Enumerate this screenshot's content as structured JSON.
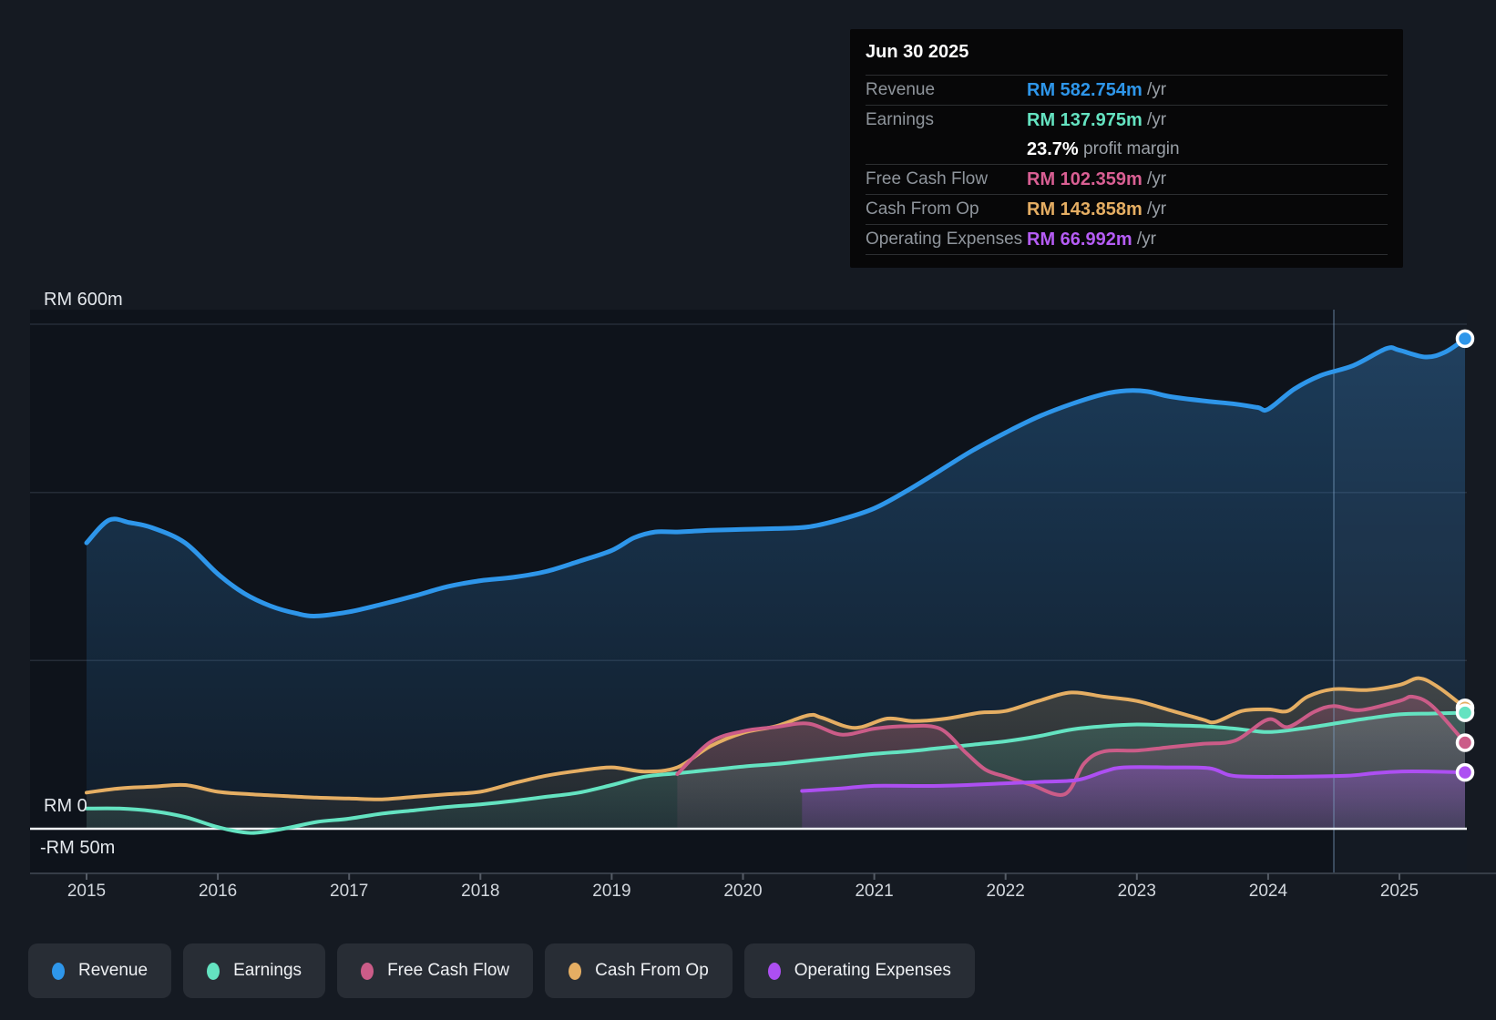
{
  "tooltip": {
    "date": "Jun 30 2025",
    "rows": [
      {
        "label": "Revenue",
        "value": "RM 582.754m",
        "suffix": " /yr",
        "color": "#2e96ea"
      },
      {
        "label": "Earnings",
        "value": "RM 137.975m",
        "suffix": " /yr",
        "color": "#64e3c1"
      },
      {
        "label": "",
        "value": "23.7%",
        "suffix": " profit margin",
        "color": "#ffffff",
        "sub": true
      },
      {
        "label": "Free Cash Flow",
        "value": "RM 102.359m",
        "suffix": " /yr",
        "color": "#d95f93"
      },
      {
        "label": "Cash From Op",
        "value": "RM 143.858m",
        "suffix": " /yr",
        "color": "#e5ae63"
      },
      {
        "label": "Operating Expenses",
        "value": "RM 66.992m",
        "suffix": " /yr",
        "color": "#b55cf5"
      }
    ]
  },
  "y_axis": {
    "top_label": "RM 600m",
    "zero_label": "RM 0",
    "negative_label": "-RM 50m"
  },
  "x_axis": {
    "years": [
      "2015",
      "2016",
      "2017",
      "2018",
      "2019",
      "2020",
      "2021",
      "2022",
      "2023",
      "2024",
      "2025"
    ]
  },
  "legend": [
    {
      "label": "Revenue",
      "color": "#2e96ea"
    },
    {
      "label": "Earnings",
      "color": "#64e3c1"
    },
    {
      "label": "Free Cash Flow",
      "color": "#cb5c88"
    },
    {
      "label": "Cash From Op",
      "color": "#e5ae63"
    },
    {
      "label": "Operating Expenses",
      "color": "#ad4ff2"
    }
  ],
  "chart_data": {
    "type": "area",
    "title": "Earnings and revenue history (RM millions per year)",
    "x_unit": "year",
    "x_range": [
      2015.0,
      2025.5
    ],
    "ylim": [
      -50,
      600
    ],
    "currency": "RM",
    "gridline_values_m": [
      600,
      400,
      200
    ],
    "zero_line_value": 0,
    "today_marker_year": 2024.5,
    "legend_position": "bottom",
    "series": [
      {
        "name": "Revenue",
        "color": "#2e96ea",
        "line_width": 5,
        "points": [
          [
            2015.0,
            340
          ],
          [
            2015.17,
            367
          ],
          [
            2015.33,
            364
          ],
          [
            2015.5,
            358
          ],
          [
            2015.75,
            340
          ],
          [
            2016.0,
            303
          ],
          [
            2016.2,
            280
          ],
          [
            2016.4,
            265
          ],
          [
            2016.6,
            256
          ],
          [
            2016.75,
            253
          ],
          [
            2017.0,
            258
          ],
          [
            2017.25,
            267
          ],
          [
            2017.5,
            277
          ],
          [
            2017.75,
            288
          ],
          [
            2018.0,
            295
          ],
          [
            2018.25,
            299
          ],
          [
            2018.5,
            306
          ],
          [
            2018.75,
            318
          ],
          [
            2019.0,
            331
          ],
          [
            2019.17,
            346
          ],
          [
            2019.33,
            353
          ],
          [
            2019.5,
            353
          ],
          [
            2019.75,
            355
          ],
          [
            2020.0,
            356
          ],
          [
            2020.25,
            357
          ],
          [
            2020.5,
            359
          ],
          [
            2020.75,
            368
          ],
          [
            2021.0,
            381
          ],
          [
            2021.25,
            402
          ],
          [
            2021.5,
            426
          ],
          [
            2021.75,
            450
          ],
          [
            2022.0,
            471
          ],
          [
            2022.25,
            490
          ],
          [
            2022.5,
            505
          ],
          [
            2022.75,
            517
          ],
          [
            2022.92,
            521
          ],
          [
            2023.08,
            520
          ],
          [
            2023.25,
            514
          ],
          [
            2023.5,
            509
          ],
          [
            2023.75,
            505
          ],
          [
            2023.92,
            501
          ],
          [
            2024.0,
            499
          ],
          [
            2024.2,
            523
          ],
          [
            2024.4,
            539
          ],
          [
            2024.65,
            551
          ],
          [
            2024.9,
            571
          ],
          [
            2025.0,
            569
          ],
          [
            2025.2,
            561
          ],
          [
            2025.35,
            567
          ],
          [
            2025.5,
            582.754
          ]
        ]
      },
      {
        "name": "Cash From Op",
        "color": "#e5ae63",
        "line_width": 4,
        "points": [
          [
            2015.0,
            43
          ],
          [
            2015.25,
            48
          ],
          [
            2015.5,
            50
          ],
          [
            2015.75,
            52
          ],
          [
            2016.0,
            44
          ],
          [
            2016.25,
            41
          ],
          [
            2016.5,
            39
          ],
          [
            2016.75,
            37
          ],
          [
            2017.0,
            36
          ],
          [
            2017.25,
            35
          ],
          [
            2017.5,
            38
          ],
          [
            2017.75,
            41
          ],
          [
            2018.0,
            44
          ],
          [
            2018.25,
            54
          ],
          [
            2018.5,
            63
          ],
          [
            2018.75,
            69
          ],
          [
            2019.0,
            73
          ],
          [
            2019.25,
            68
          ],
          [
            2019.5,
            73
          ],
          [
            2019.75,
            98
          ],
          [
            2020.0,
            114
          ],
          [
            2020.25,
            122
          ],
          [
            2020.5,
            135
          ],
          [
            2020.6,
            132
          ],
          [
            2020.85,
            120
          ],
          [
            2021.1,
            131
          ],
          [
            2021.3,
            128
          ],
          [
            2021.55,
            131
          ],
          [
            2021.8,
            138
          ],
          [
            2022.0,
            140
          ],
          [
            2022.25,
            152
          ],
          [
            2022.5,
            162
          ],
          [
            2022.75,
            157
          ],
          [
            2023.0,
            152
          ],
          [
            2023.25,
            141
          ],
          [
            2023.5,
            130
          ],
          [
            2023.6,
            127
          ],
          [
            2023.8,
            140
          ],
          [
            2024.0,
            142
          ],
          [
            2024.15,
            140
          ],
          [
            2024.3,
            157
          ],
          [
            2024.5,
            166
          ],
          [
            2024.75,
            165
          ],
          [
            2025.0,
            171
          ],
          [
            2025.15,
            179
          ],
          [
            2025.3,
            168
          ],
          [
            2025.5,
            143.858
          ]
        ]
      },
      {
        "name": "Free Cash Flow",
        "color": "#cb5c88",
        "line_width": 4,
        "points": [
          [
            2019.5,
            65
          ],
          [
            2019.75,
            103
          ],
          [
            2020.0,
            116
          ],
          [
            2020.25,
            121
          ],
          [
            2020.5,
            125
          ],
          [
            2020.75,
            112
          ],
          [
            2021.0,
            119
          ],
          [
            2021.25,
            122
          ],
          [
            2021.5,
            119
          ],
          [
            2021.7,
            90
          ],
          [
            2021.85,
            70
          ],
          [
            2022.0,
            62
          ],
          [
            2022.2,
            52
          ],
          [
            2022.45,
            41
          ],
          [
            2022.6,
            78
          ],
          [
            2022.75,
            92
          ],
          [
            2023.0,
            93
          ],
          [
            2023.25,
            97
          ],
          [
            2023.5,
            101
          ],
          [
            2023.75,
            105
          ],
          [
            2024.0,
            130
          ],
          [
            2024.15,
            121
          ],
          [
            2024.35,
            139
          ],
          [
            2024.5,
            146
          ],
          [
            2024.7,
            141
          ],
          [
            2025.0,
            152
          ],
          [
            2025.1,
            157
          ],
          [
            2025.25,
            146
          ],
          [
            2025.5,
            102.359
          ]
        ]
      },
      {
        "name": "Earnings",
        "color": "#64e3c1",
        "line_width": 4,
        "points": [
          [
            2015.0,
            24
          ],
          [
            2015.25,
            24
          ],
          [
            2015.5,
            21
          ],
          [
            2015.75,
            14
          ],
          [
            2016.0,
            2
          ],
          [
            2016.25,
            -5
          ],
          [
            2016.5,
            0
          ],
          [
            2016.75,
            8
          ],
          [
            2017.0,
            12
          ],
          [
            2017.25,
            18
          ],
          [
            2017.5,
            22
          ],
          [
            2017.75,
            26
          ],
          [
            2018.0,
            29
          ],
          [
            2018.25,
            33
          ],
          [
            2018.5,
            38
          ],
          [
            2018.75,
            43
          ],
          [
            2019.0,
            52
          ],
          [
            2019.25,
            62
          ],
          [
            2019.5,
            66
          ],
          [
            2019.75,
            70
          ],
          [
            2020.0,
            74
          ],
          [
            2020.25,
            77
          ],
          [
            2020.5,
            81
          ],
          [
            2020.75,
            85
          ],
          [
            2021.0,
            89
          ],
          [
            2021.25,
            92
          ],
          [
            2021.5,
            96
          ],
          [
            2021.75,
            100
          ],
          [
            2022.0,
            104
          ],
          [
            2022.25,
            110
          ],
          [
            2022.5,
            118
          ],
          [
            2022.75,
            122
          ],
          [
            2023.0,
            124
          ],
          [
            2023.25,
            123
          ],
          [
            2023.5,
            122
          ],
          [
            2023.75,
            119
          ],
          [
            2024.0,
            115
          ],
          [
            2024.25,
            119
          ],
          [
            2024.5,
            125
          ],
          [
            2024.75,
            131
          ],
          [
            2025.0,
            136
          ],
          [
            2025.25,
            137
          ],
          [
            2025.5,
            137.975
          ]
        ]
      },
      {
        "name": "Operating Expenses",
        "color": "#ad4ff2",
        "line_width": 4,
        "points": [
          [
            2020.45,
            45
          ],
          [
            2020.75,
            48
          ],
          [
            2021.0,
            51
          ],
          [
            2021.5,
            51
          ],
          [
            2022.0,
            54
          ],
          [
            2022.3,
            56
          ],
          [
            2022.55,
            58
          ],
          [
            2022.75,
            68
          ],
          [
            2022.9,
            73
          ],
          [
            2023.25,
            73
          ],
          [
            2023.55,
            72
          ],
          [
            2023.7,
            64
          ],
          [
            2023.85,
            62
          ],
          [
            2024.25,
            62
          ],
          [
            2024.6,
            63
          ],
          [
            2024.8,
            66
          ],
          [
            2025.0,
            68
          ],
          [
            2025.25,
            68
          ],
          [
            2025.5,
            66.992
          ]
        ]
      }
    ]
  }
}
